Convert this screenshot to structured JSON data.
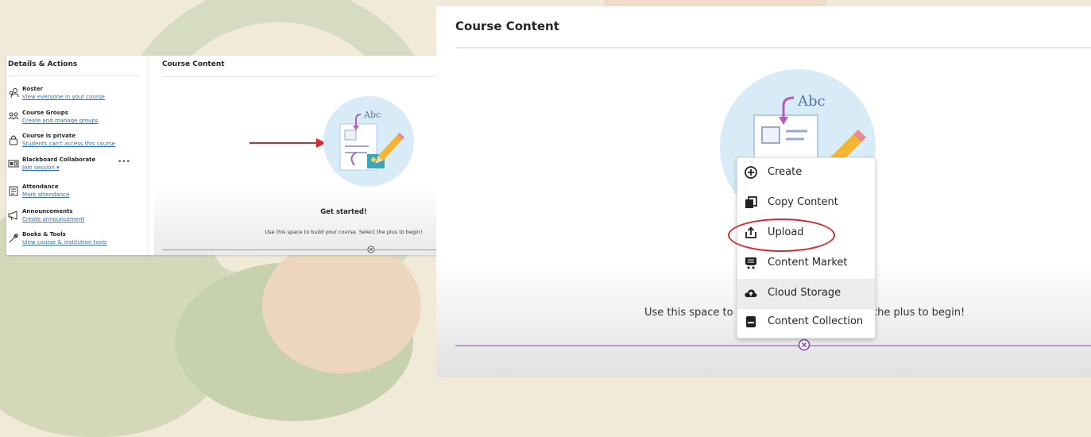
{
  "left_panel": {
    "sidebar": {
      "title": "Details & Actions",
      "items": [
        {
          "icon": "roster-icon",
          "label": "Roster",
          "link": "View everyone in your course"
        },
        {
          "icon": "groups-icon",
          "label": "Course Groups",
          "link": "Create and manage groups"
        },
        {
          "icon": "lock-icon",
          "label": "Course is private",
          "link": "Students can't access this course"
        },
        {
          "icon": "collaborate-icon",
          "label": "Blackboard Collaborate",
          "link": "Join session"
        },
        {
          "icon": "attendance-icon",
          "label": "Attendance",
          "link": "Mark attendance"
        },
        {
          "icon": "megaphone-icon",
          "label": "Announcements",
          "link": "Create announcement"
        },
        {
          "icon": "wrench-icon",
          "label": "Books & Tools",
          "link": "View course & institution tools"
        }
      ],
      "more": "•••"
    },
    "main": {
      "title": "Course Content",
      "illustration_text": "Abc",
      "get_started": "Get started!",
      "get_started_sub": "Use this space to build your course. Select the plus to begin!"
    }
  },
  "right_panel": {
    "title": "Course Content",
    "illustration_text": "Abc",
    "sub_left": "Use this space to",
    "sub_right": "the plus to begin!",
    "menu": [
      {
        "icon": "plus-circle-icon",
        "label": "Create"
      },
      {
        "icon": "copy-icon",
        "label": "Copy Content"
      },
      {
        "icon": "upload-icon",
        "label": "Upload"
      },
      {
        "icon": "cart-icon",
        "label": "Content Market"
      },
      {
        "icon": "cloud-icon",
        "label": "Cloud Storage"
      },
      {
        "icon": "collection-icon",
        "label": "Content Collection"
      }
    ]
  },
  "colors": {
    "background": "#f2ead9",
    "link": "#2a6fb7",
    "annotation_red": "#d8282e",
    "plus_line": "#b79ac8"
  }
}
